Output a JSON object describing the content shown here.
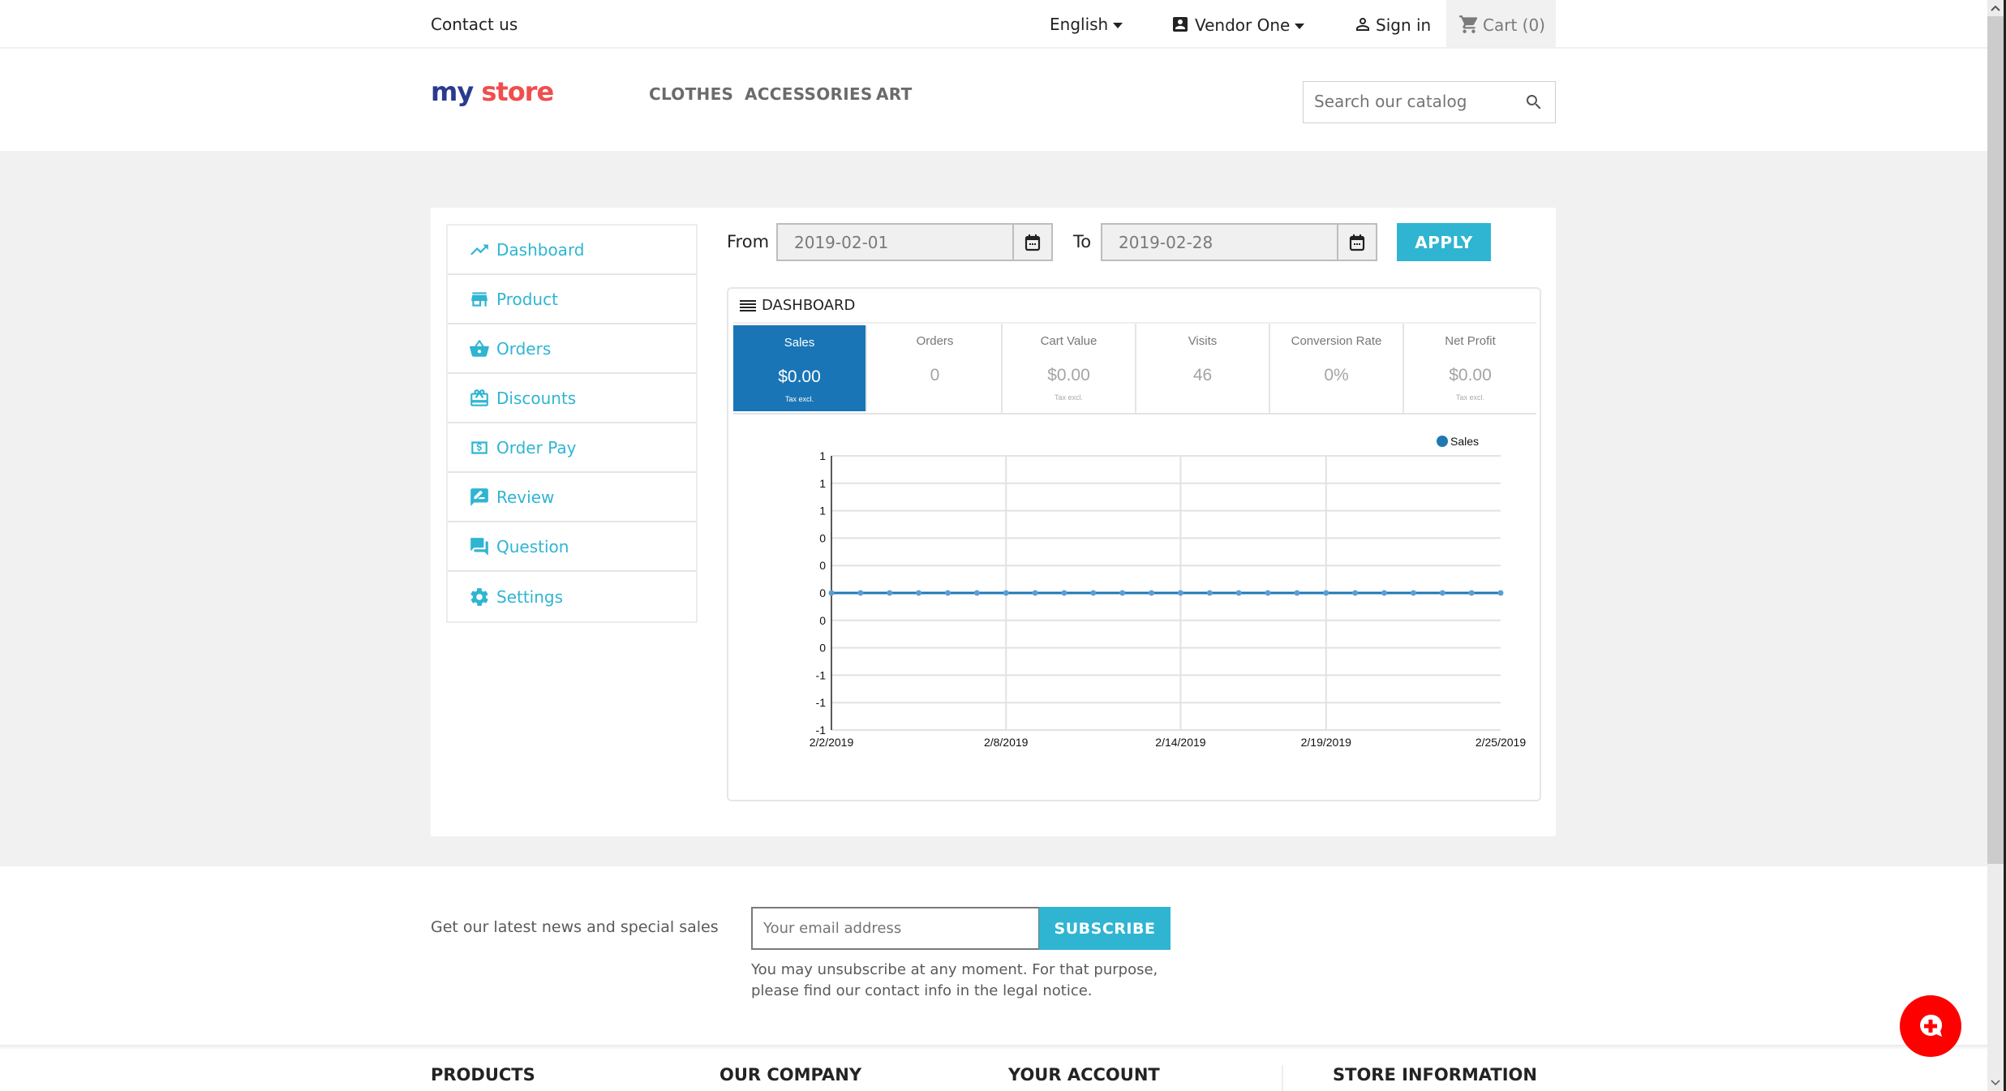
{
  "topbar": {
    "contact": "Contact us",
    "language": "English",
    "account": "Vendor One",
    "sign_in": "Sign in",
    "cart": "Cart (0)"
  },
  "header": {
    "logo_part1": "my",
    "logo_part2": "store",
    "nav": [
      "CLOTHES",
      "ACCESSORIES",
      "ART"
    ],
    "search_placeholder": "Search our catalog"
  },
  "sidebar": {
    "items": [
      {
        "label": "Dashboard",
        "icon": "trending-up-icon"
      },
      {
        "label": "Product",
        "icon": "store-icon"
      },
      {
        "label": "Orders",
        "icon": "basket-icon"
      },
      {
        "label": "Discounts",
        "icon": "gift-card-icon"
      },
      {
        "label": "Order Pay",
        "icon": "dollar-icon"
      },
      {
        "label": "Review",
        "icon": "rate-review-icon"
      },
      {
        "label": "Question",
        "icon": "forum-icon"
      },
      {
        "label": "Settings",
        "icon": "gear-icon"
      }
    ]
  },
  "filter": {
    "from_label": "From",
    "from_value": "2019-02-01",
    "to_label": "To",
    "to_value": "2019-02-28",
    "apply_label": "APPLY"
  },
  "dashboard": {
    "title": "DASHBOARD",
    "stats": [
      {
        "label": "Sales",
        "value": "$0.00",
        "note": "Tax excl.",
        "active": true
      },
      {
        "label": "Orders",
        "value": "0",
        "note": "",
        "active": false
      },
      {
        "label": "Cart Value",
        "value": "$0.00",
        "note": "Tax excl.",
        "active": false
      },
      {
        "label": "Visits",
        "value": "46",
        "note": "",
        "active": false
      },
      {
        "label": "Conversion Rate",
        "value": "0%",
        "note": "",
        "active": false
      },
      {
        "label": "Net Profit",
        "value": "$0.00",
        "note": "Tax excl.",
        "active": false
      }
    ],
    "colors": {
      "active_stat": "#1a75b6",
      "accent": "#2fb5d2",
      "series": "#1f77b4"
    }
  },
  "chart_data": {
    "type": "line",
    "title": "",
    "xlabel": "",
    "ylabel": "",
    "x": [
      "2/2/2019",
      "2/3/2019",
      "2/4/2019",
      "2/5/2019",
      "2/6/2019",
      "2/7/2019",
      "2/8/2019",
      "2/9/2019",
      "2/10/2019",
      "2/11/2019",
      "2/12/2019",
      "2/13/2019",
      "2/14/2019",
      "2/15/2019",
      "2/16/2019",
      "2/17/2019",
      "2/18/2019",
      "2/19/2019",
      "2/20/2019",
      "2/21/2019",
      "2/22/2019",
      "2/23/2019",
      "2/24/2019",
      "2/25/2019"
    ],
    "series": [
      {
        "name": "Sales",
        "values": [
          0,
          0,
          0,
          0,
          0,
          0,
          0,
          0,
          0,
          0,
          0,
          0,
          0,
          0,
          0,
          0,
          0,
          0,
          0,
          0,
          0,
          0,
          0,
          0
        ]
      }
    ],
    "x_tick_labels": [
      "2/2/2019",
      "2/8/2019",
      "2/14/2019",
      "2/19/2019",
      "2/25/2019"
    ],
    "x_tick_indices": [
      0,
      6,
      12,
      17,
      23
    ],
    "y_tick_labels": [
      "1",
      "1",
      "1",
      "0",
      "0",
      "0",
      "0",
      "0",
      "-1",
      "-1",
      "-1"
    ],
    "ylim": [
      -1,
      1
    ],
    "grid": true,
    "legend": "top-right"
  },
  "newsletter": {
    "label": "Get our latest news and special sales",
    "email_placeholder": "Your email address",
    "subscribe_label": "SUBSCRIBE",
    "note": "You may unsubscribe at any moment. For that purpose, please find our contact info in the legal notice."
  },
  "footer": {
    "headings": [
      "PRODUCTS",
      "OUR COMPANY",
      "YOUR ACCOUNT",
      "STORE INFORMATION"
    ]
  }
}
